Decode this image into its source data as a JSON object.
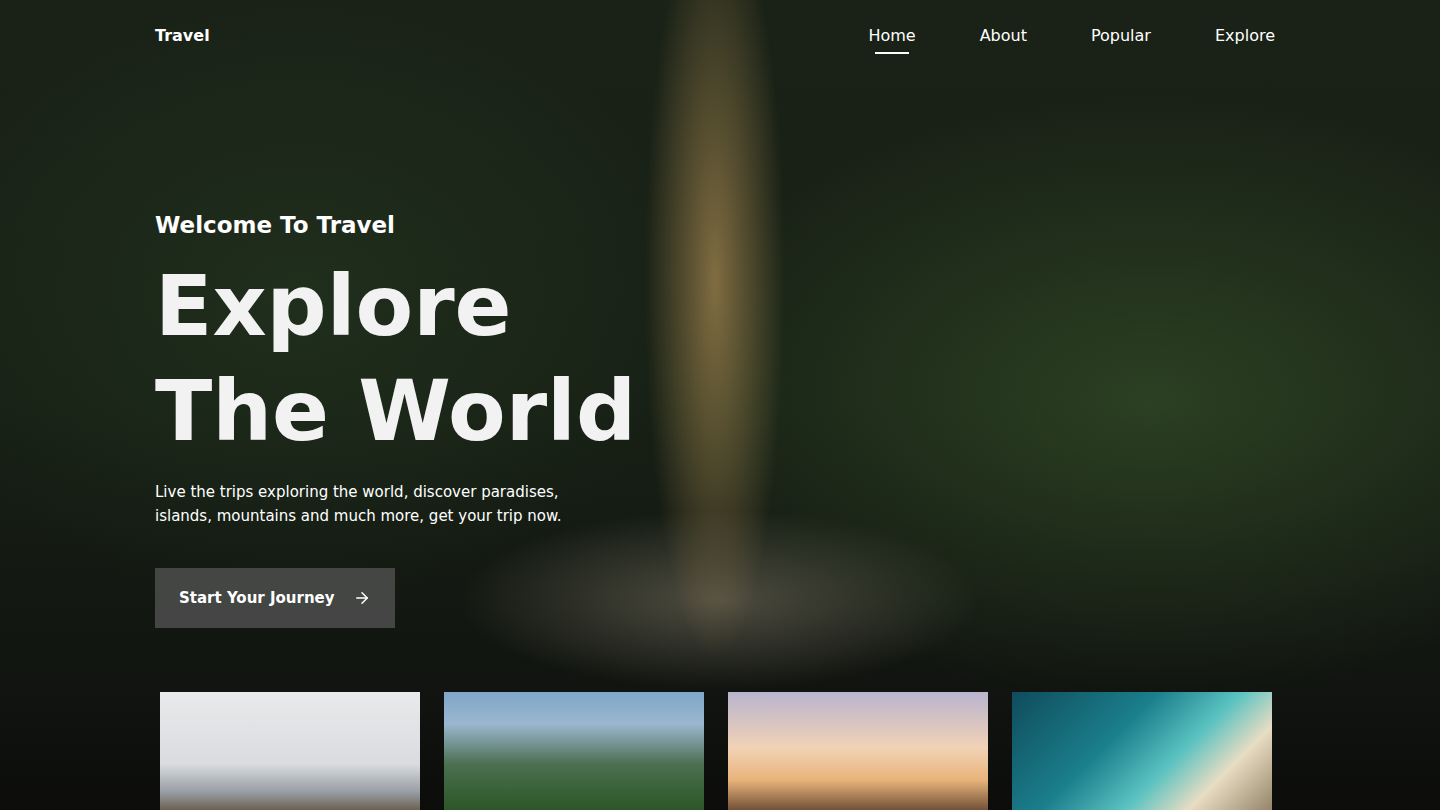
{
  "nav": {
    "logo": "Travel",
    "links": [
      {
        "label": "Home",
        "selected": true
      },
      {
        "label": "About",
        "selected": false
      },
      {
        "label": "Popular",
        "selected": false
      },
      {
        "label": "Explore",
        "selected": false
      }
    ]
  },
  "hero": {
    "subtitle": "Welcome To Travel",
    "title_lines": [
      "Explore",
      "The World"
    ],
    "description": "Live the trips exploring the world, discover paradises, islands, mountains and much more, get your trip now.",
    "button": "Start Your Journey"
  }
}
